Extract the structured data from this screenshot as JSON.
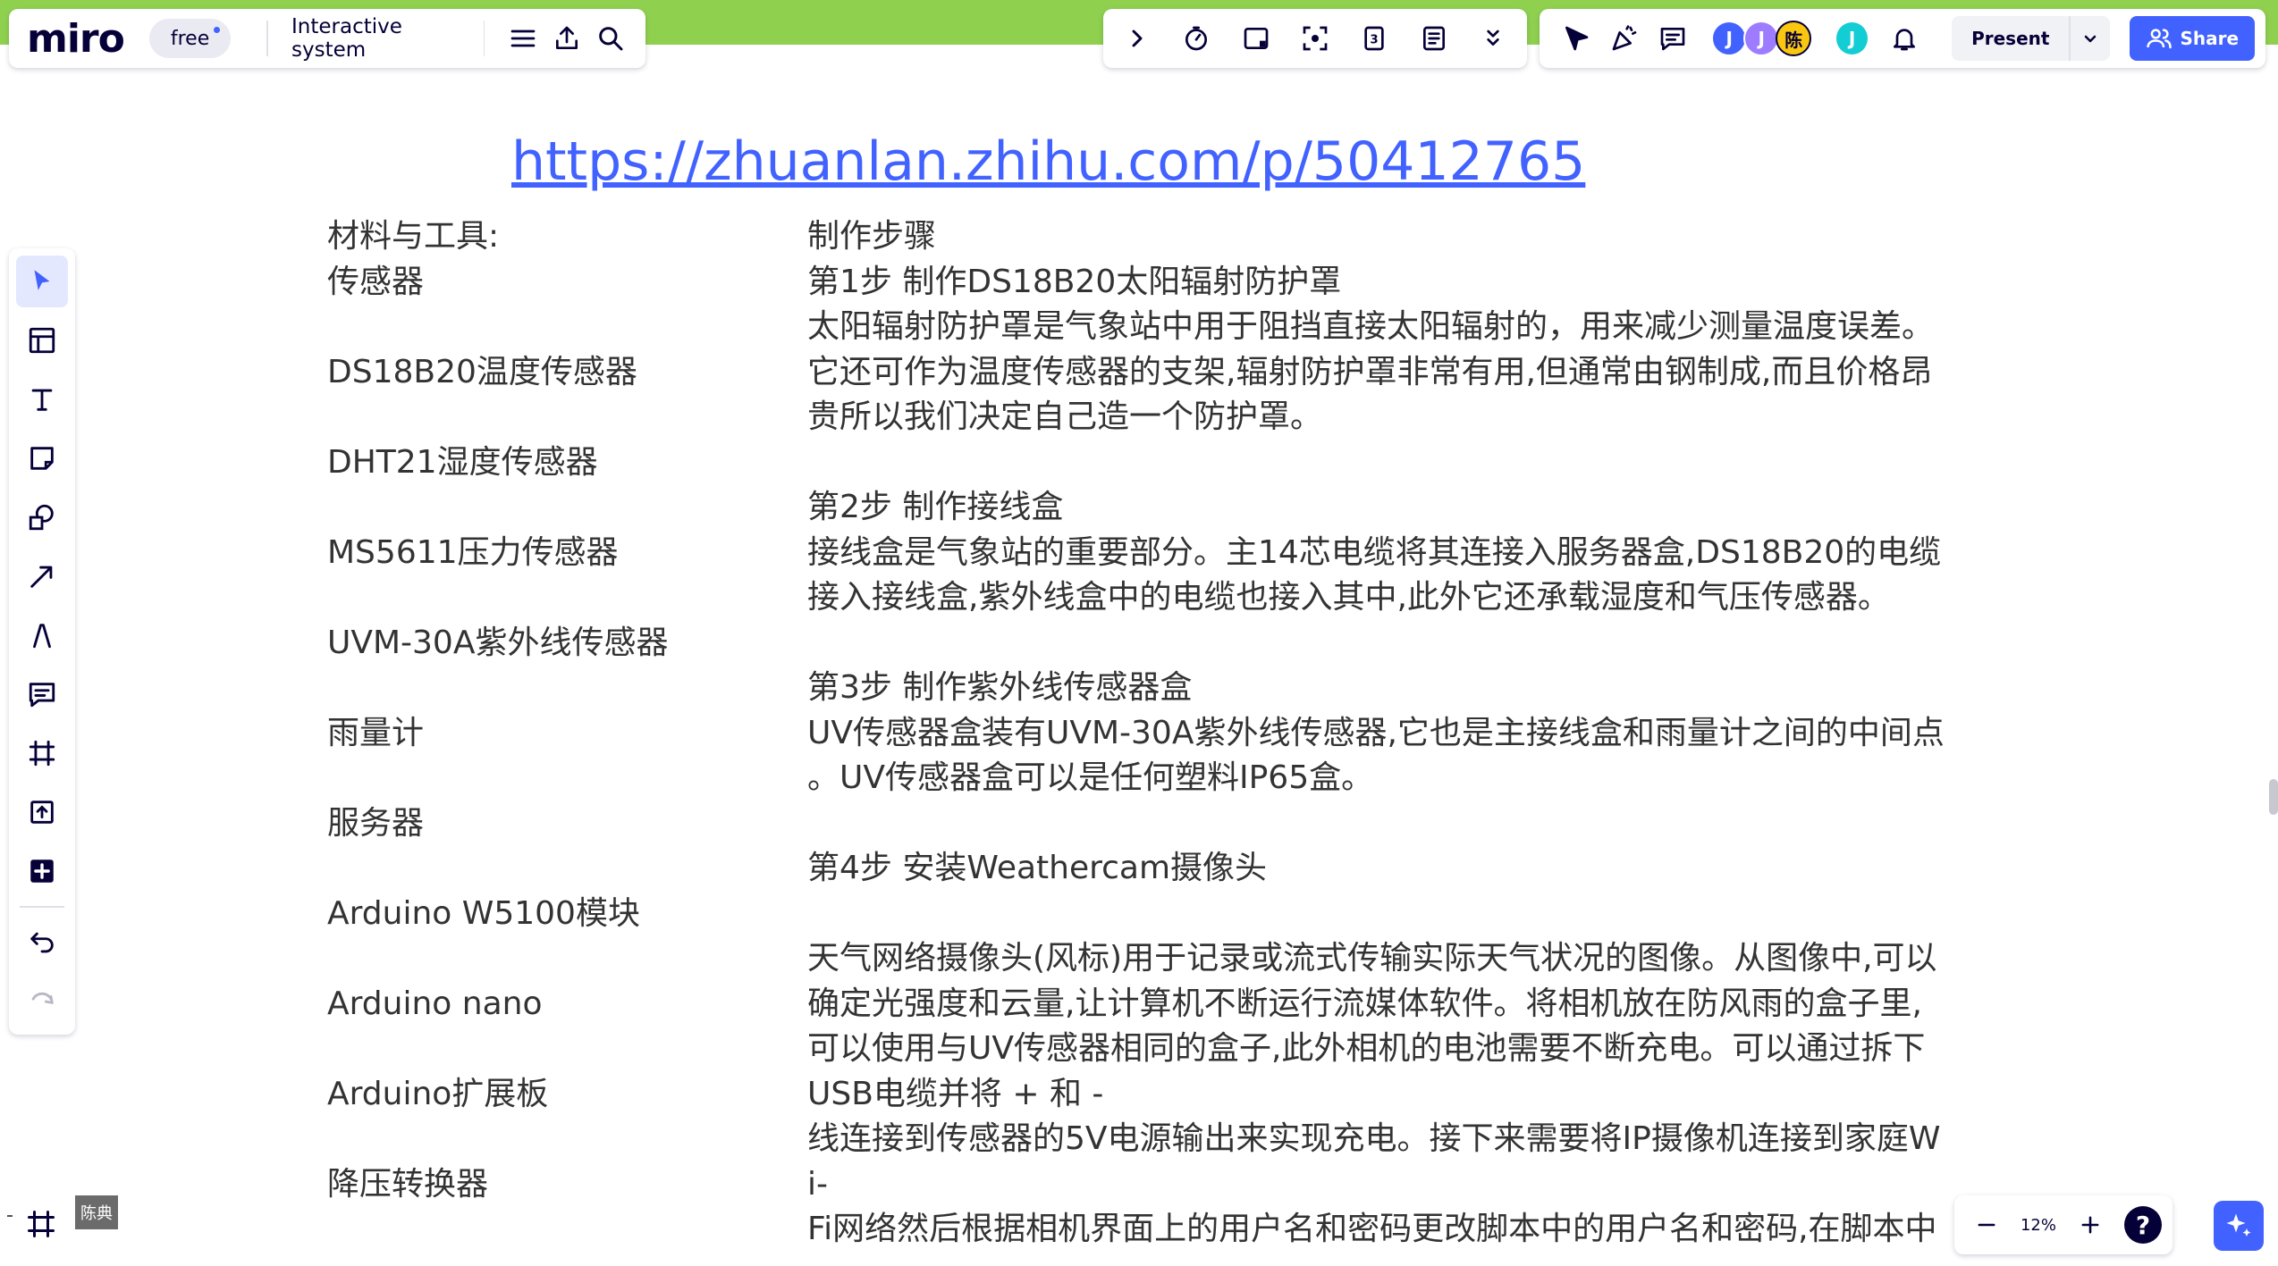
{
  "app": {
    "logo": "miro",
    "plan_badge": "free",
    "board_title": "Interactive system"
  },
  "top_right": {
    "avatars": [
      {
        "initial": "J",
        "color": "#4262ff"
      },
      {
        "initial": "J",
        "color": "#9d7cff"
      },
      {
        "initial": "陈",
        "color": "#fac710"
      }
    ],
    "self_avatar": {
      "initial": "J",
      "color": "#12cdd4"
    },
    "present_label": "Present",
    "share_label": "Share"
  },
  "board": {
    "link": "https://zhuanlan.zhihu.com/p/50412765",
    "materials": [
      "材料与工具:",
      "传感器",
      "",
      "DS18B20温度传感器",
      "",
      "DHT21湿度传感器",
      "",
      "MS5611压力传感器",
      "",
      "UVM-30A紫外线传感器",
      "",
      "雨量计",
      "",
      "服务器",
      "",
      "Arduino W5100模块",
      "",
      "Arduino nano",
      "",
      "Arduino扩展板",
      "",
      "降压转换器"
    ],
    "steps": [
      "制作步骤",
      "第1步 制作DS18B20太阳辐射防护罩",
      "太阳辐射防护罩是气象站中用于阻挡直接太阳辐射的，用来减少测量温度误差。",
      "它还可作为温度传感器的支架,辐射防护罩非常有用,但通常由钢制成,而且价格昂",
      "贵所以我们决定自己造一个防护罩。",
      "",
      "第2步 制作接线盒",
      "接线盒是气象站的重要部分。主14芯电缆将其连接入服务器盒,DS18B20的电缆",
      "接入接线盒,紫外线盒中的电缆也接入其中,此外它还承载湿度和气压传感器。",
      "",
      "第3步 制作紫外线传感器盒",
      "UV传感器盒装有UVM-30A紫外线传感器,它也是主接线盒和雨量计之间的中间点",
      "。UV传感器盒可以是任何塑料IP65盒。",
      "",
      "第4步 安装Weathercam摄像头",
      "",
      "天气网络摄像头(风标)用于记录或流式传输实际天气状况的图像。从图像中,可以",
      "确定光强度和云量,让计算机不断运行流媒体软件。将相机放在防风雨的盒子里,",
      "可以使用与UV传感器相同的盒子,此外相机的电池需要不断充电。可以通过拆下",
      "USB电缆并将 + 和 -",
      "线连接到传感器的5V电源输出来实现充电。接下来需要将IP摄像机连接到家庭W",
      "i-",
      "Fi网络然后根据相机界面上的用户名和密码更改脚本中的用户名和密码,在脚本中"
    ]
  },
  "cursor_label": "陈典",
  "zoom": {
    "level": "12%",
    "help": "?"
  }
}
